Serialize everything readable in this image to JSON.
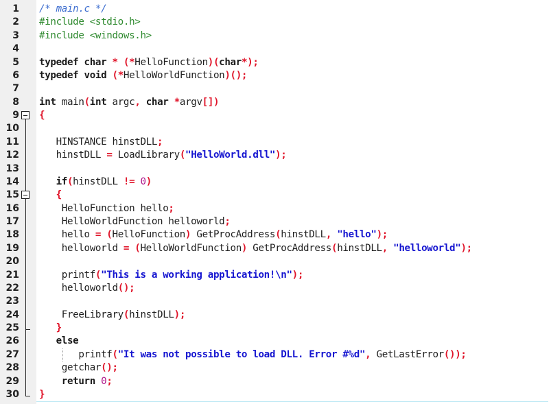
{
  "editor": {
    "filename_comment": "/* main.c */",
    "lines": [
      {
        "n": "1",
        "tokens": [
          {
            "t": "comment",
            "v": "/* main.c */"
          }
        ]
      },
      {
        "n": "2",
        "tokens": [
          {
            "t": "pre",
            "v": "#include <stdio.h>"
          }
        ]
      },
      {
        "n": "3",
        "tokens": [
          {
            "t": "pre",
            "v": "#include <windows.h>"
          }
        ]
      },
      {
        "n": "4",
        "tokens": []
      },
      {
        "n": "5",
        "tokens": [
          {
            "t": "kw",
            "v": "typedef char "
          },
          {
            "t": "op",
            "v": "* ("
          },
          {
            "t": "op",
            "v": "*"
          },
          {
            "t": "id",
            "v": "HelloFunction"
          },
          {
            "t": "op",
            "v": ")("
          },
          {
            "t": "kw",
            "v": "char"
          },
          {
            "t": "op",
            "v": "*);"
          }
        ]
      },
      {
        "n": "6",
        "tokens": [
          {
            "t": "kw",
            "v": "typedef void "
          },
          {
            "t": "op",
            "v": "("
          },
          {
            "t": "op",
            "v": "*"
          },
          {
            "t": "id",
            "v": "HelloWorldFunction"
          },
          {
            "t": "op",
            "v": ")();"
          }
        ]
      },
      {
        "n": "7",
        "tokens": []
      },
      {
        "n": "8",
        "tokens": [
          {
            "t": "kw",
            "v": "int "
          },
          {
            "t": "id",
            "v": "main"
          },
          {
            "t": "op",
            "v": "("
          },
          {
            "t": "kw",
            "v": "int "
          },
          {
            "t": "id",
            "v": "argc"
          },
          {
            "t": "op",
            "v": ", "
          },
          {
            "t": "kw",
            "v": "char "
          },
          {
            "t": "op",
            "v": "*"
          },
          {
            "t": "id",
            "v": "argv"
          },
          {
            "t": "op",
            "v": "[])"
          }
        ]
      },
      {
        "n": "9",
        "tokens": [
          {
            "t": "op",
            "v": "{"
          }
        ]
      },
      {
        "n": "10",
        "tokens": []
      },
      {
        "n": "11",
        "tokens": [
          {
            "t": "id",
            "v": "   HINSTANCE hinstDLL"
          },
          {
            "t": "op",
            "v": ";"
          }
        ]
      },
      {
        "n": "12",
        "tokens": [
          {
            "t": "id",
            "v": "   hinstDLL "
          },
          {
            "t": "op",
            "v": "= "
          },
          {
            "t": "id",
            "v": "LoadLibrary"
          },
          {
            "t": "op",
            "v": "("
          },
          {
            "t": "str",
            "v": "\"HelloWorld.dll\""
          },
          {
            "t": "op",
            "v": ");"
          }
        ]
      },
      {
        "n": "13",
        "tokens": []
      },
      {
        "n": "14",
        "tokens": [
          {
            "t": "kw",
            "v": "   if"
          },
          {
            "t": "op",
            "v": "("
          },
          {
            "t": "id",
            "v": "hinstDLL "
          },
          {
            "t": "op",
            "v": "!= "
          },
          {
            "t": "num",
            "v": "0"
          },
          {
            "t": "op",
            "v": ")"
          }
        ]
      },
      {
        "n": "15",
        "tokens": [
          {
            "t": "op",
            "v": "   {"
          }
        ]
      },
      {
        "n": "16",
        "tokens": [
          {
            "t": "id",
            "v": "    HelloFunction hello"
          },
          {
            "t": "op",
            "v": ";"
          }
        ]
      },
      {
        "n": "17",
        "tokens": [
          {
            "t": "id",
            "v": "    HelloWorldFunction helloworld"
          },
          {
            "t": "op",
            "v": ";"
          }
        ]
      },
      {
        "n": "18",
        "tokens": [
          {
            "t": "id",
            "v": "    hello "
          },
          {
            "t": "op",
            "v": "= ("
          },
          {
            "t": "id",
            "v": "HelloFunction"
          },
          {
            "t": "op",
            "v": ") "
          },
          {
            "t": "id",
            "v": "GetProcAddress"
          },
          {
            "t": "op",
            "v": "("
          },
          {
            "t": "id",
            "v": "hinstDLL"
          },
          {
            "t": "op",
            "v": ", "
          },
          {
            "t": "str",
            "v": "\"hello\""
          },
          {
            "t": "op",
            "v": ");"
          }
        ]
      },
      {
        "n": "19",
        "tokens": [
          {
            "t": "id",
            "v": "    helloworld "
          },
          {
            "t": "op",
            "v": "= ("
          },
          {
            "t": "id",
            "v": "HelloWorldFunction"
          },
          {
            "t": "op",
            "v": ") "
          },
          {
            "t": "id",
            "v": "GetProcAddress"
          },
          {
            "t": "op",
            "v": "("
          },
          {
            "t": "id",
            "v": "hinstDLL"
          },
          {
            "t": "op",
            "v": ", "
          },
          {
            "t": "str",
            "v": "\"helloworld\""
          },
          {
            "t": "op",
            "v": ");"
          }
        ]
      },
      {
        "n": "20",
        "tokens": []
      },
      {
        "n": "21",
        "tokens": [
          {
            "t": "id",
            "v": "    printf"
          },
          {
            "t": "op",
            "v": "("
          },
          {
            "t": "str",
            "v": "\"This is a working application!\\n\""
          },
          {
            "t": "op",
            "v": ");"
          }
        ]
      },
      {
        "n": "22",
        "tokens": [
          {
            "t": "id",
            "v": "    helloworld"
          },
          {
            "t": "op",
            "v": "();"
          }
        ]
      },
      {
        "n": "23",
        "tokens": []
      },
      {
        "n": "24",
        "tokens": [
          {
            "t": "id",
            "v": "    FreeLibrary"
          },
          {
            "t": "op",
            "v": "("
          },
          {
            "t": "id",
            "v": "hinstDLL"
          },
          {
            "t": "op",
            "v": ");"
          }
        ]
      },
      {
        "n": "25",
        "tokens": [
          {
            "t": "op",
            "v": "   }"
          }
        ]
      },
      {
        "n": "26",
        "tokens": [
          {
            "t": "kw",
            "v": "   else"
          }
        ]
      },
      {
        "n": "27",
        "tokens": [
          {
            "t": "id",
            "v": "       printf"
          },
          {
            "t": "op",
            "v": "("
          },
          {
            "t": "str",
            "v": "\"It was not possible to load DLL. Error #%d\""
          },
          {
            "t": "op",
            "v": ", "
          },
          {
            "t": "id",
            "v": "GetLastError"
          },
          {
            "t": "op",
            "v": "());"
          }
        ]
      },
      {
        "n": "28",
        "tokens": [
          {
            "t": "id",
            "v": "    getchar"
          },
          {
            "t": "op",
            "v": "();"
          }
        ]
      },
      {
        "n": "29",
        "tokens": [
          {
            "t": "kw",
            "v": "    return "
          },
          {
            "t": "num",
            "v": "0"
          },
          {
            "t": "op",
            "v": ";"
          }
        ]
      },
      {
        "n": "30",
        "tokens": [
          {
            "t": "op",
            "v": "}"
          }
        ]
      }
    ],
    "fold_markers": [
      {
        "line": "9",
        "state": "expanded",
        "icon": "minus-box-icon"
      },
      {
        "line": "15",
        "state": "expanded",
        "icon": "minus-box-icon"
      }
    ]
  }
}
